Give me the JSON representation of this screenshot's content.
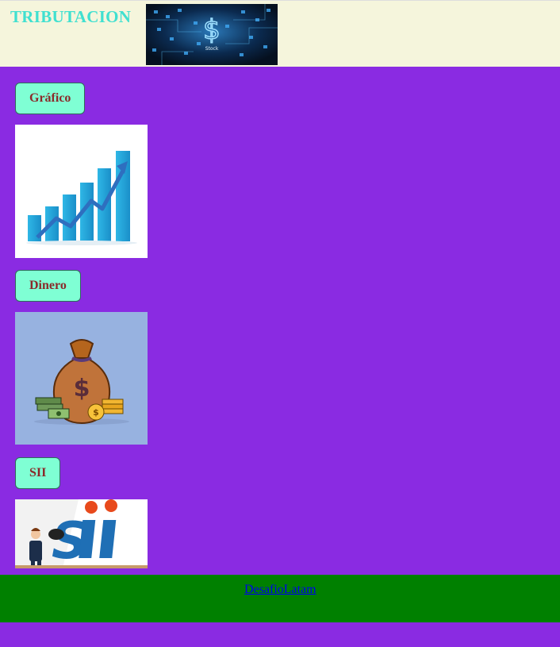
{
  "header": {
    "title": "TRIBUTACION",
    "hero_text": "Stock"
  },
  "sections": [
    {
      "button_label": "Gráfico"
    },
    {
      "button_label": "Dinero"
    },
    {
      "button_label": "SII"
    }
  ],
  "footer": {
    "link_text": "DesafioLatam"
  },
  "colors": {
    "page_bg": "#8a2be2",
    "header_bg": "#f5f5dc",
    "title": "#40e0d0",
    "button_bg": "#7fffd4",
    "button_text": "#8b2a2a",
    "footer_bg": "#008000",
    "link": "#0000ee"
  }
}
